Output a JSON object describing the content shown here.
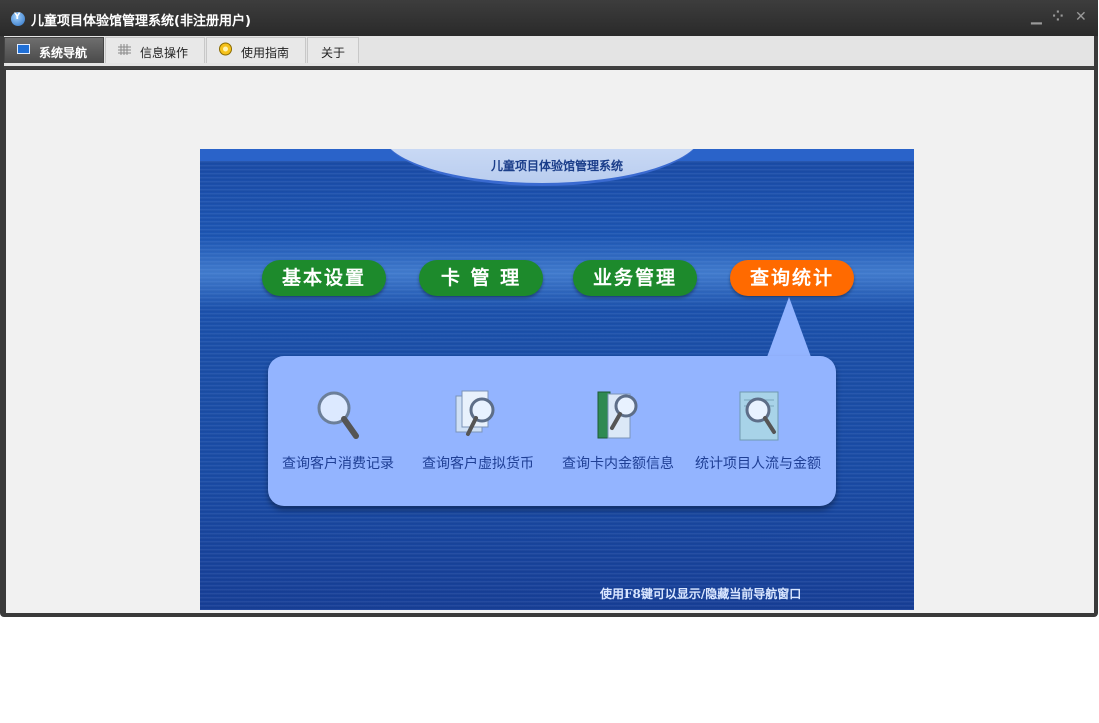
{
  "window": {
    "title": "儿童项目体验馆管理系统(非注册用户)"
  },
  "tabs": [
    {
      "label": "系统导航",
      "icon": "monitor-icon",
      "active": true
    },
    {
      "label": "信息操作",
      "icon": "grid-icon",
      "active": false
    },
    {
      "label": "使用指南",
      "icon": "lightbulb-icon",
      "active": false
    },
    {
      "label": "关于",
      "icon": "",
      "active": false
    }
  ],
  "panel": {
    "title": "儿童项目体验馆管理系统",
    "nav": [
      {
        "label": "基本设置"
      },
      {
        "label": "卡 管 理"
      },
      {
        "label": "业务管理"
      },
      {
        "label": "查询统计",
        "active": true
      }
    ],
    "items": [
      {
        "label": "查询客户消费记录",
        "icon": "magnifier-icon"
      },
      {
        "label": "查询客户虚拟货币",
        "icon": "documents-search-icon"
      },
      {
        "label": "查询卡内金额信息",
        "icon": "book-search-icon"
      },
      {
        "label": "统计项目人流与金额",
        "icon": "document-search-icon"
      }
    ],
    "hint": "使用F8键可以显示/隐藏当前导航窗口"
  },
  "colors": {
    "nav_green": "#1d8a2c",
    "nav_active": "#ff6a00",
    "panel_blue": "#1b4fa9",
    "submenu_bg": "#93b4ff"
  }
}
